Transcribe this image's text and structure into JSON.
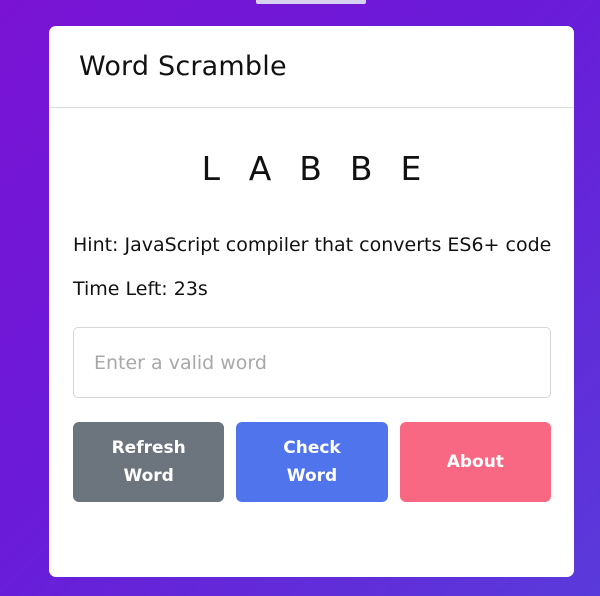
{
  "app": {
    "title": "Word Scramble"
  },
  "game": {
    "scrambled_word": "LABBE",
    "hint": "Hint: JavaScript compiler that converts ES6+ code",
    "timer": "Time Left: 23s"
  },
  "input": {
    "value": "",
    "placeholder": "Enter a valid word"
  },
  "buttons": {
    "refresh_label": "Refresh Word",
    "check_label": "Check Word",
    "about_label": "About"
  },
  "colors": {
    "refresh": "#6c757d",
    "check": "#4f74ec",
    "about": "#f96882",
    "background_start": "#7a13d4",
    "background_end": "#5a3ada"
  }
}
